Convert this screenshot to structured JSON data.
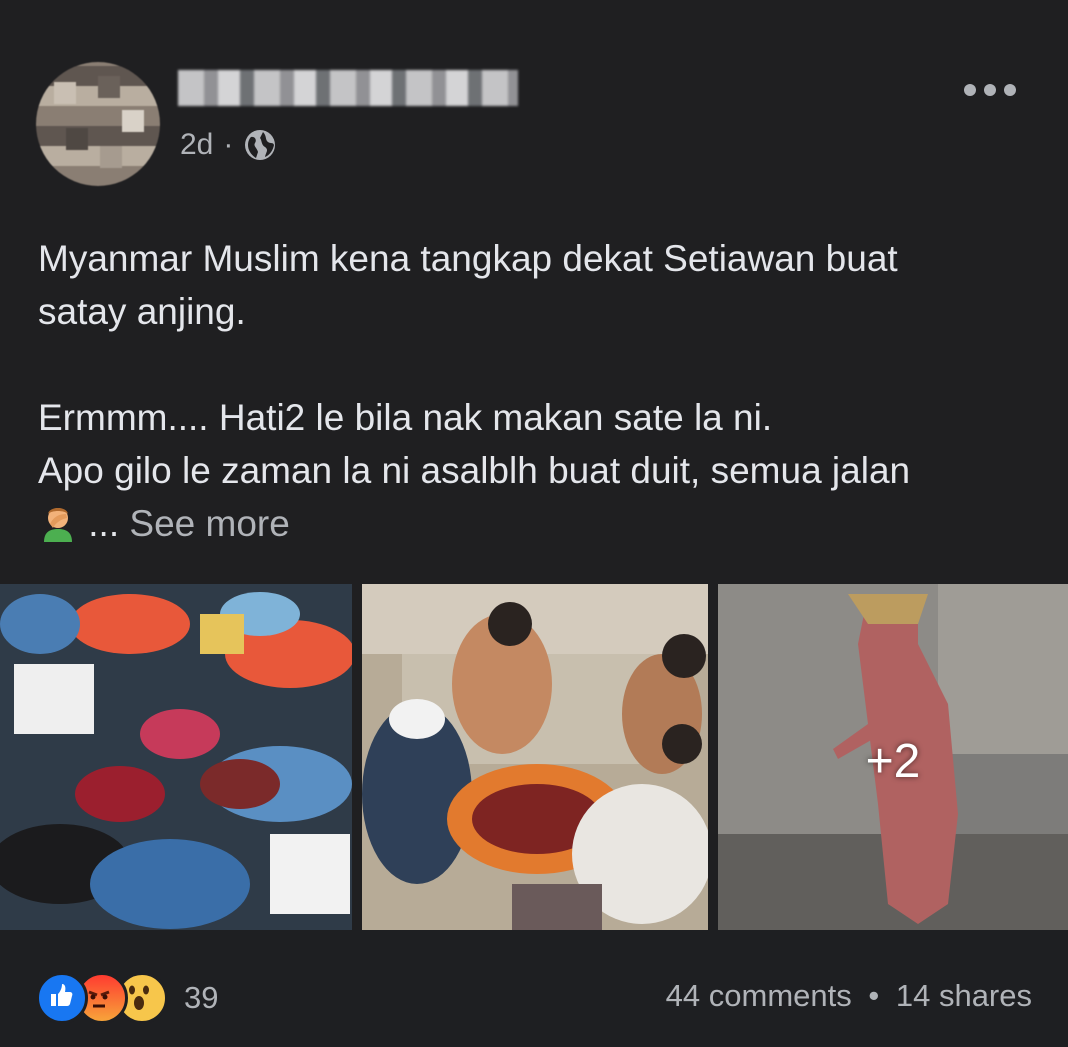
{
  "post": {
    "time": "2d",
    "separator": "·",
    "text_lines": [
      "Myanmar Muslim kena tangkap dekat Setiawan buat",
      "satay anjing.",
      "",
      "Ermmm.... Hati2 le bila nak makan sate la ni.",
      "Apo gilo le zaman la ni asalblh buat duit, semua jalan"
    ],
    "ellipsis": "...",
    "see_more": "See more",
    "photos_overflow": "+2"
  },
  "footer": {
    "reactions_count": "39",
    "comments": "44 comments",
    "bullet": "•",
    "shares": "14 shares"
  },
  "colors": {
    "background": "#1f1f21",
    "text": "#e4e6eb",
    "secondary": "#b0b3b8",
    "like": "#1877f2"
  },
  "icons": [
    "globe-icon",
    "more-options-icon",
    "facepalm-emoji-icon",
    "like-reaction-icon",
    "angry-reaction-icon",
    "wow-reaction-icon"
  ]
}
